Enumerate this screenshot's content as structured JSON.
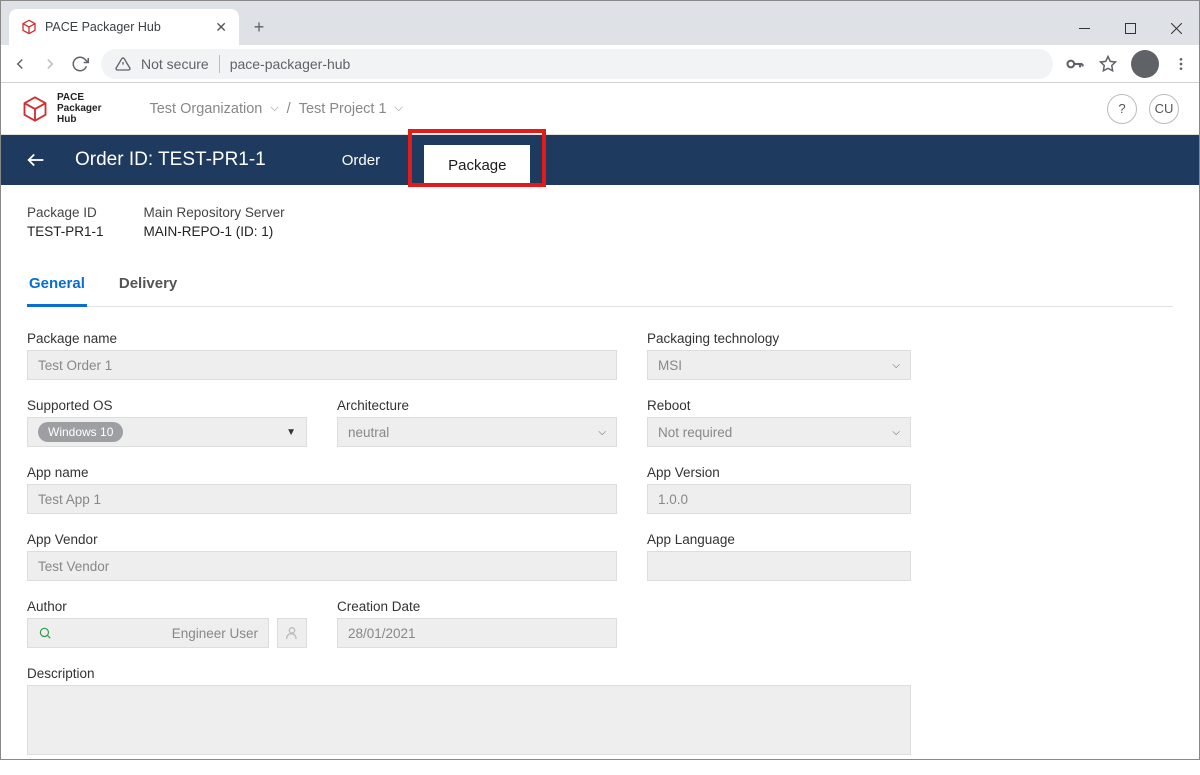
{
  "browser": {
    "tab_title": "PACE Packager Hub",
    "not_secure": "Not secure",
    "url": "pace-packager-hub"
  },
  "app": {
    "logo_lines": "PACE\nPackager\nHub",
    "org": "Test Organization",
    "project": "Test Project 1",
    "user_initials": "CU"
  },
  "bluebar": {
    "title": "Order ID: TEST-PR1-1",
    "tab_order": "Order",
    "tab_package": "Package"
  },
  "info": {
    "pkg_id_label": "Package ID",
    "pkg_id_value": "TEST-PR1-1",
    "repo_label": "Main Repository Server",
    "repo_value": "MAIN-REPO-1 (ID: 1)"
  },
  "subtabs": {
    "general": "General",
    "delivery": "Delivery"
  },
  "fields": {
    "package_name": {
      "label": "Package name",
      "value": "Test Order 1"
    },
    "packaging_tech": {
      "label": "Packaging technology",
      "value": "MSI"
    },
    "supported_os": {
      "label": "Supported OS",
      "chip": "Windows 10"
    },
    "architecture": {
      "label": "Architecture",
      "value": "neutral"
    },
    "reboot": {
      "label": "Reboot",
      "value": "Not required"
    },
    "app_name": {
      "label": "App name",
      "value": "Test App 1"
    },
    "app_version": {
      "label": "App Version",
      "value": "1.0.0"
    },
    "app_vendor": {
      "label": "App Vendor",
      "value": "Test Vendor"
    },
    "app_language": {
      "label": "App Language",
      "value": ""
    },
    "author": {
      "label": "Author",
      "value": "Engineer User"
    },
    "creation_date": {
      "label": "Creation Date",
      "value": "28/01/2021"
    },
    "description": {
      "label": "Description",
      "value": ""
    }
  }
}
